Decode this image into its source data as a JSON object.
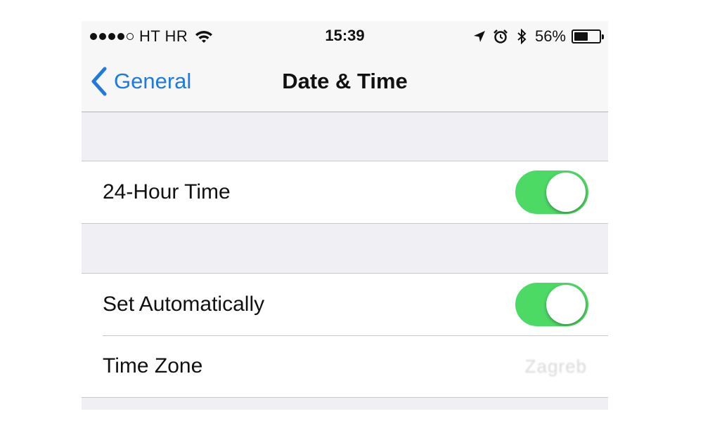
{
  "status_bar": {
    "carrier": "HT HR",
    "time": "15:39",
    "battery_percent": "56%",
    "battery_level": 0.56,
    "signal_bars_filled": 4,
    "signal_bars_total": 5
  },
  "nav": {
    "back_label": "General",
    "title": "Date & Time"
  },
  "settings": {
    "hour24": {
      "label": "24-Hour Time",
      "enabled": true
    },
    "set_auto": {
      "label": "Set Automatically",
      "enabled": true
    },
    "time_zone": {
      "label": "Time Zone",
      "value": "Zagreb"
    }
  },
  "colors": {
    "toggle_on": "#4cd964",
    "accent": "#1f7ae0",
    "background": "#efeff4"
  }
}
